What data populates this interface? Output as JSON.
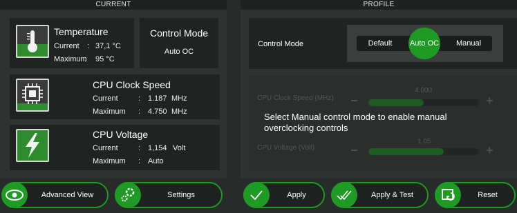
{
  "current": {
    "title": "CURRENT",
    "temperature": {
      "title": "Temperature",
      "current_label": "Current",
      "current_sep": ":",
      "current_value": "37,1 °C",
      "max_label": "Maximum",
      "max_sep": ":",
      "max_value": "95 °C",
      "level": 0.4
    },
    "control_mode": {
      "title": "Control Mode",
      "value": "Auto OC"
    },
    "clock": {
      "title": "CPU Clock Speed",
      "current_label": "Current",
      "current_sep": ":",
      "current_value": "1.187",
      "current_unit": "MHz",
      "max_label": "Maximum",
      "max_sep": ":",
      "max_value": "4.750",
      "max_unit": "MHz"
    },
    "voltage": {
      "title": "CPU Voltage",
      "current_label": "Current",
      "current_sep": ":",
      "current_value": "1,154",
      "current_unit": "Volt",
      "max_label": "Maximum",
      "max_sep": ":",
      "max_value": "Auto"
    }
  },
  "profile": {
    "title": "PROFILE",
    "control_mode_label": "Control Mode",
    "modes": [
      "Default",
      "Auto OC",
      "Manual"
    ],
    "selected_mode": "Auto OC",
    "clock_label": "CPU Clock Speed (MHz)",
    "clock_value": "4.000",
    "clock_fill": 0.5,
    "voltage_label": "CPU Voltage (Volt)",
    "voltage_value": "1,05",
    "voltage_fill": 0.68,
    "minus": "−",
    "plus": "+",
    "overlay_line1": "Select Manual control mode to enable manual",
    "overlay_line2": "overclocking controls"
  },
  "buttons": {
    "advanced_view": "Advanced View",
    "settings": "Settings",
    "apply": "Apply",
    "apply_test": "Apply & Test",
    "reset": "Reset"
  },
  "colors": {
    "accent": "#1f9a24",
    "panel": "#2e3332",
    "card": "#1f2322"
  }
}
